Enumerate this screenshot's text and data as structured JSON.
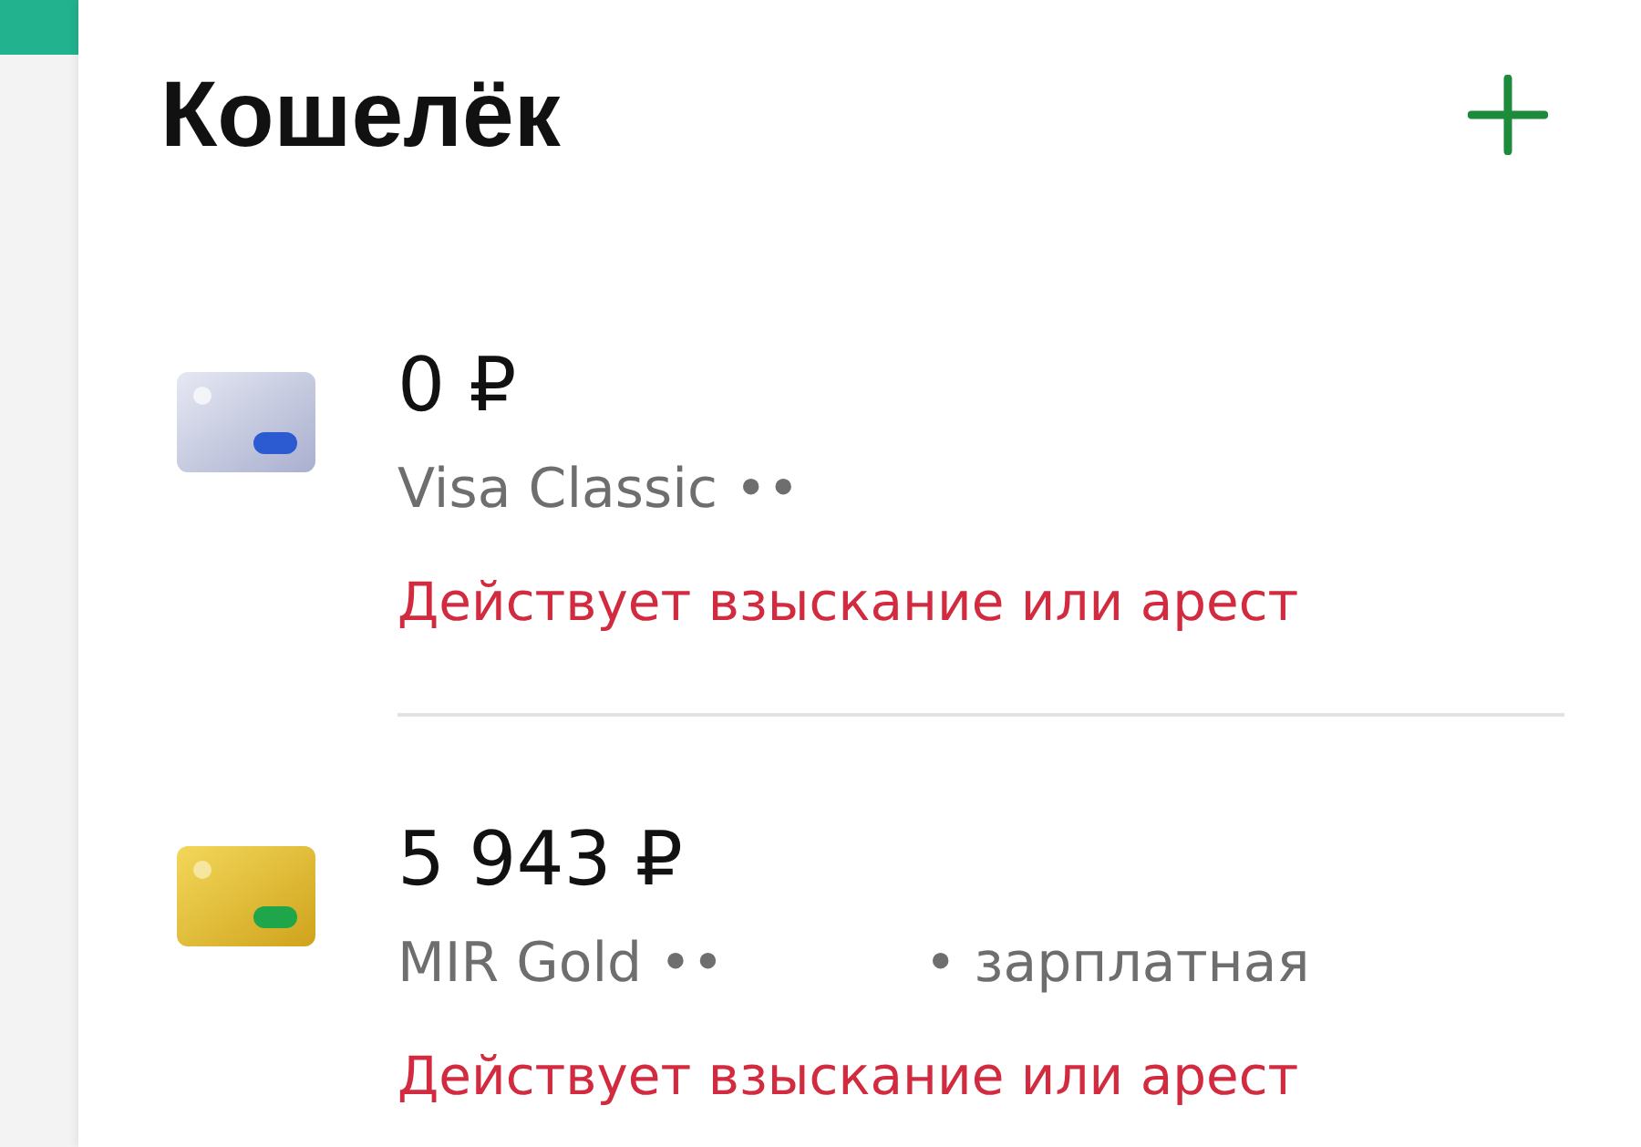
{
  "header": {
    "title": "Кошелёк"
  },
  "accounts": [
    {
      "kind": "silver",
      "balance": "0 ₽",
      "card_name": "Visa Classic ••",
      "warning": "Действует взыскание или арест"
    },
    {
      "kind": "gold",
      "balance": "5 943 ₽",
      "card_name": "MIR Gold ••",
      "tag": "• зарплатная",
      "warning": "Действует взыскание или арест"
    }
  ]
}
